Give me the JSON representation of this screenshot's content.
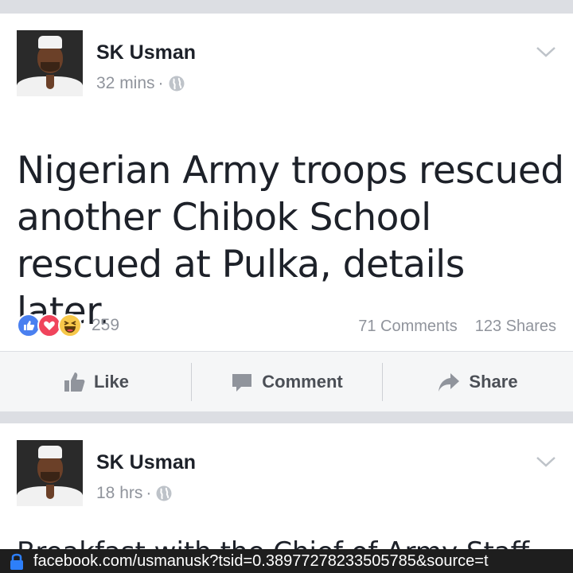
{
  "posts": [
    {
      "author": "SK Usman",
      "time": "32 mins",
      "separator": "·",
      "text": "Nigerian Army troops rescued another Chibok School rescued at Pulka, details later.",
      "reaction_count": "259",
      "comments": "71 Comments",
      "shares": "123 Shares",
      "actions": {
        "like": "Like",
        "comment": "Comment",
        "share": "Share"
      }
    },
    {
      "author": "SK Usman",
      "time": "18 hrs",
      "separator": "·",
      "text": "Breakfast with the Chief of Army Staff"
    }
  ],
  "url_bar": {
    "url": "facebook.com/usmanusk?tsid=0.38977278233505785&source=t"
  },
  "colors": {
    "like": "#4a80f0",
    "love": "#f0445c",
    "haha": "#f7c84a",
    "meta_gray": "#90949c",
    "action_bar_bg": "#f5f6f7"
  },
  "icons": [
    "globe-icon",
    "chevron-down-icon",
    "like-reaction-icon",
    "love-reaction-icon",
    "haha-reaction-icon",
    "thumbs-up-icon",
    "comment-icon",
    "share-arrow-icon",
    "lock-icon"
  ]
}
